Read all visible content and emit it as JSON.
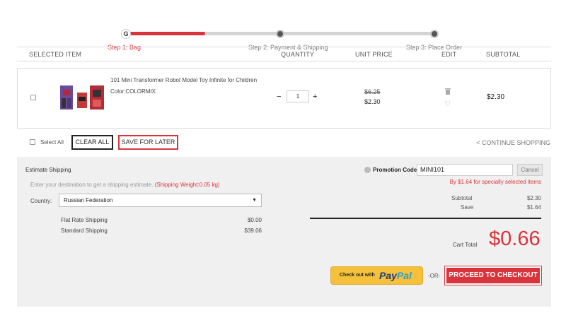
{
  "steps": {
    "first_pin_letter": "G",
    "items": [
      {
        "label": "Step 1: Bag",
        "active": true
      },
      {
        "label": "Step 2: Payment & Shipping",
        "active": false
      },
      {
        "label": "Step 3: Place Order",
        "active": false
      }
    ]
  },
  "table_header": {
    "selected_item": "SELECTED ITEM",
    "quantity": "QUANTITY",
    "unit_price": "UNIT PRICE",
    "edit": "EDIT",
    "subtotal": "SUBTOTAL"
  },
  "item": {
    "title": "101 Mini Transformer Robot Model Toy Infinite for Children",
    "color": "Color:COLORMIX",
    "quantity": "1",
    "minus": "−",
    "plus": "+",
    "old_price": "$6.25",
    "unit_price": "$2.30",
    "subtotal": "$2.30"
  },
  "actions": {
    "select_all": "Select All",
    "clear_all": "CLEAR ALL",
    "save_for_later": "SAVE FOR LATER",
    "continue_shopping": "< CONTINUE SHOPPING"
  },
  "shipping": {
    "title": "Estimate Shipping",
    "hint": "Enter your destination to get a shipping estimate.",
    "weight": "(Shipping Weight:0.05 kg)",
    "country_label": "Country:",
    "country_value": "Russian Federation",
    "options": [
      {
        "name": "Flat Rate Shipping",
        "price": "$0.00"
      },
      {
        "name": "Standard Shipping",
        "price": "$39.06"
      }
    ]
  },
  "promo": {
    "label": "Promotion Code:",
    "value": "MINI101",
    "cancel": "Cancel",
    "note": "By $1.64 for specially selected items"
  },
  "summary": {
    "subtotal_label": "Subtotal",
    "subtotal_value": "$2.30",
    "save_label": "Save",
    "save_value": "$1.64",
    "cart_total_label": "Cart Total",
    "cart_total_value": "$0.66"
  },
  "checkout": {
    "paypal_prefix": "Check out with",
    "paypal_brand_1": "Pay",
    "paypal_brand_2": "Pal",
    "or": "-OR-",
    "proceed": "PROCEED TO CHECKOUT"
  },
  "colors": {
    "accent": "#d9343c",
    "paypal_yellow": "#f5c13a",
    "panel_bg": "#f0f0f0"
  }
}
